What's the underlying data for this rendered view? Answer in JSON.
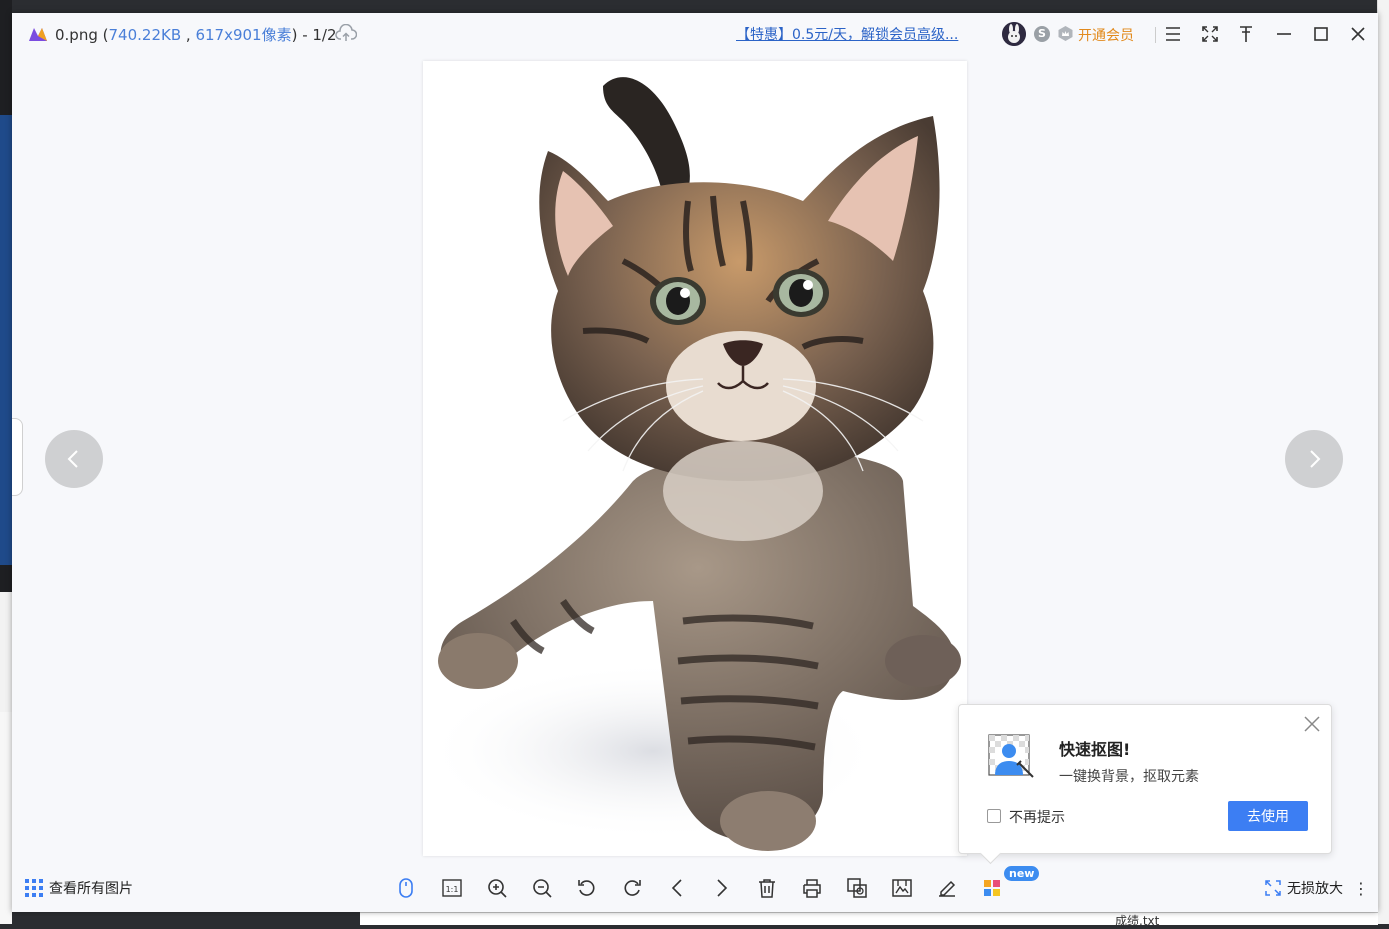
{
  "titlebar": {
    "file_name": "0.png",
    "paren_open": " (",
    "file_size": "740.22KB",
    "comma": " , ",
    "dimensions": "617x901像素",
    "paren_close": ")",
    "page_index": " - 1/2",
    "promo_text": "【特惠】0.5元/天，解锁会员高级...",
    "vip_badge": "S",
    "vip_label": "开通会员"
  },
  "popup": {
    "title": "快速抠图!",
    "description": "一键换背景，抠取元素",
    "checkbox_label": "不再提示",
    "button_label": "去使用"
  },
  "toolbar": {
    "view_all_label": "查看所有图片",
    "new_badge": "new",
    "lossless_label": "无损放大",
    "more_label": "⋮"
  },
  "background": {
    "bottom_file": "成绩.txt"
  },
  "colors": {
    "accent": "#3c7ef3",
    "vip": "#e28a1d",
    "meta_blue": "#4a7fd8"
  }
}
